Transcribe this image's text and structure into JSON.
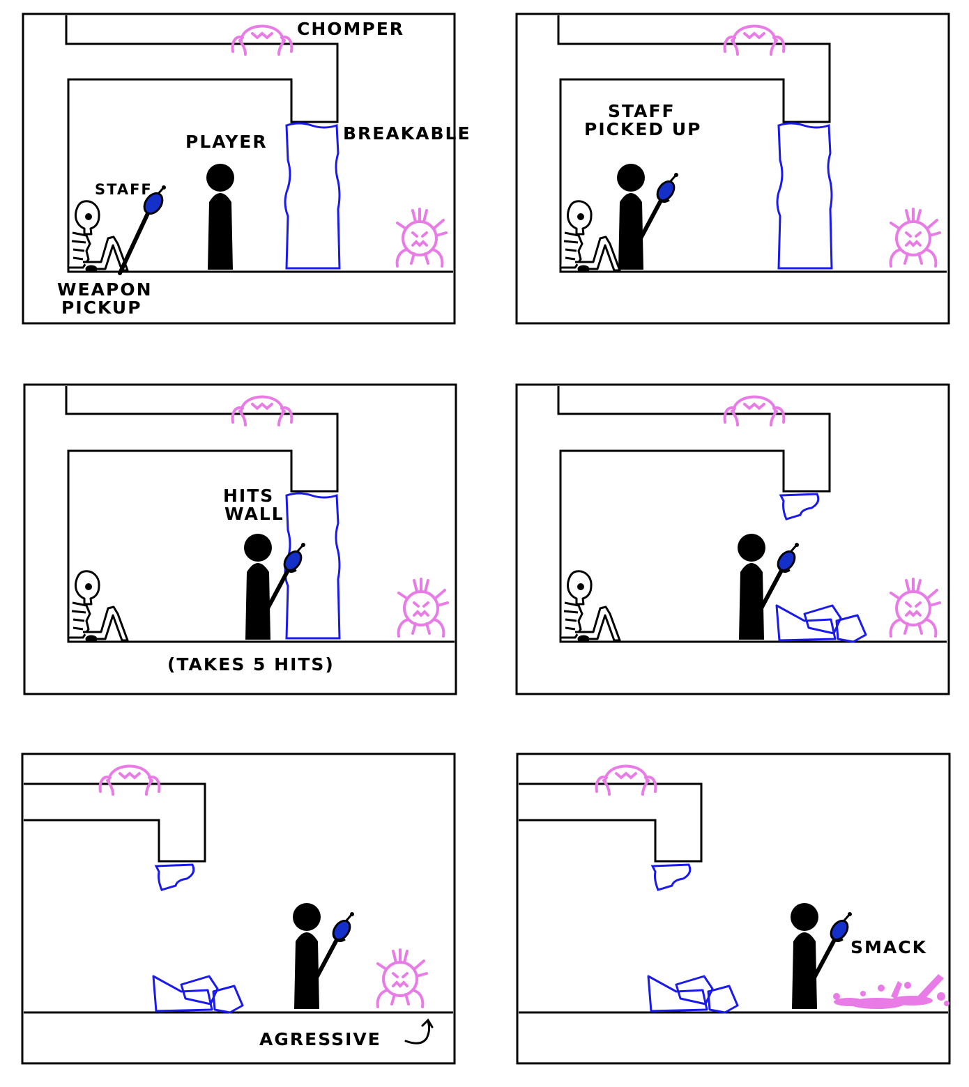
{
  "colors": {
    "ink": "#000000",
    "breakable": "#1a1aee",
    "staff_orb": "#1530c8",
    "enemy": "#e97be6"
  },
  "icons": {
    "player": "player-figure-icon",
    "skeleton": "skeleton-icon",
    "staff": "staff-icon",
    "chomper": "chomper-icon",
    "aggressive_enemy": "spiky-enemy-icon",
    "splat": "splat-icon"
  },
  "labels": {
    "chomper": "CHOMPER",
    "breakable": "BREAKABLE",
    "player": "PLAYER",
    "staff": "STAFF",
    "weapon_pickup_1": "WEAPON",
    "weapon_pickup_2": "PICKUP",
    "staff_picked_1": "STAFF",
    "staff_picked_2": "PICKED UP",
    "hits_wall_1": "HITS",
    "hits_wall_2": "WALL",
    "takes_hits": "(TAKES 5 HITS)",
    "aggressive": "AGRESSIVE",
    "smack": "SMACK"
  }
}
